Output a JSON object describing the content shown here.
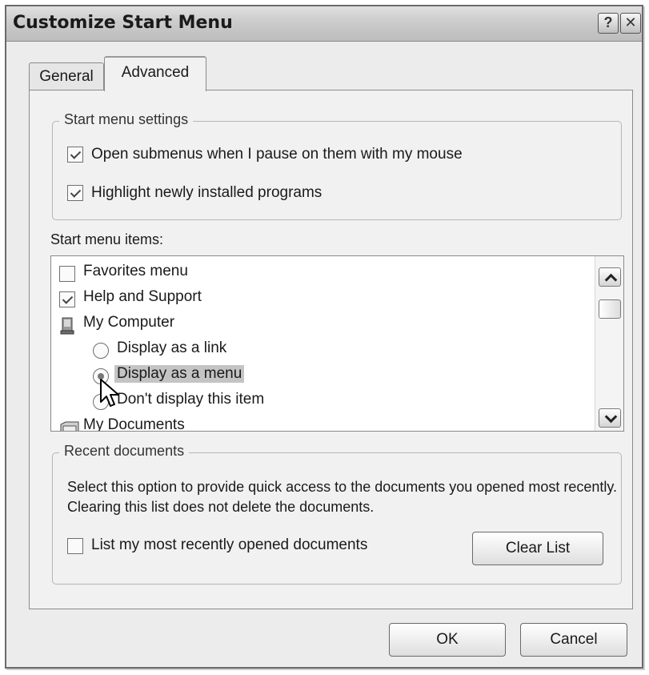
{
  "window": {
    "title": "Customize Start Menu",
    "help_glyph": "?",
    "close_glyph": "✕"
  },
  "tabs": [
    {
      "label": "General",
      "active": false
    },
    {
      "label": "Advanced",
      "active": true
    }
  ],
  "start_menu_settings": {
    "legend": "Start menu settings",
    "options": [
      {
        "label": "Open submenus when I pause on them with my mouse",
        "checked": true
      },
      {
        "label": "Highlight newly installed programs",
        "checked": true
      }
    ]
  },
  "start_menu_items": {
    "label": "Start menu items:",
    "favorites": {
      "label": "Favorites menu",
      "checked": false
    },
    "help": {
      "label": "Help and Support",
      "checked": true
    },
    "my_computer": {
      "label": "My Computer",
      "icon": "computer-icon"
    },
    "radio_link": {
      "label": "Display as a link",
      "selected": false
    },
    "radio_menu": {
      "label": "Display as a menu",
      "selected": true
    },
    "radio_none": {
      "label": "Don't display this item",
      "selected": false
    },
    "my_documents": {
      "label": "My Documents",
      "icon": "documents-icon"
    }
  },
  "recent_documents": {
    "legend": "Recent documents",
    "description": "Select this option to provide quick access to the documents you opened most recently.  Clearing this list does not delete the documents.",
    "list_option": {
      "label": "List my most recently opened documents",
      "checked": false
    },
    "clear_button": "Clear List"
  },
  "footer": {
    "ok": "OK",
    "cancel": "Cancel"
  }
}
